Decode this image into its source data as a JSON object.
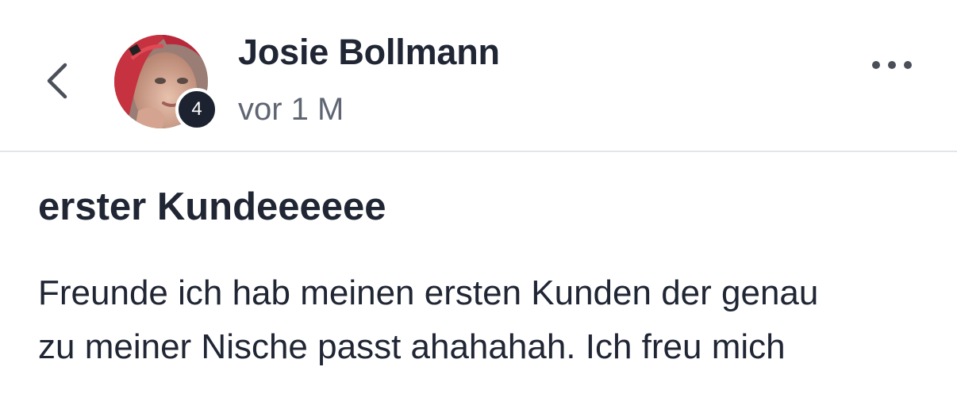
{
  "header": {
    "back_icon": "chevron-left-icon",
    "author": {
      "name": "Josie Bollmann",
      "level": "4",
      "time": "vor 1 M",
      "avatar": "profile-photo"
    },
    "more_icon": "more-horizontal-icon"
  },
  "post": {
    "title": "erster Kundeeeeee",
    "body": "Freunde ich hab meinen ersten Kunden der genau\nzu meiner Nische passt ahahahah. Ich freu mich"
  },
  "colors": {
    "text_primary": "#202634",
    "text_secondary": "#5f6573",
    "badge_bg": "#1c2230",
    "divider": "#e3e5e8"
  }
}
